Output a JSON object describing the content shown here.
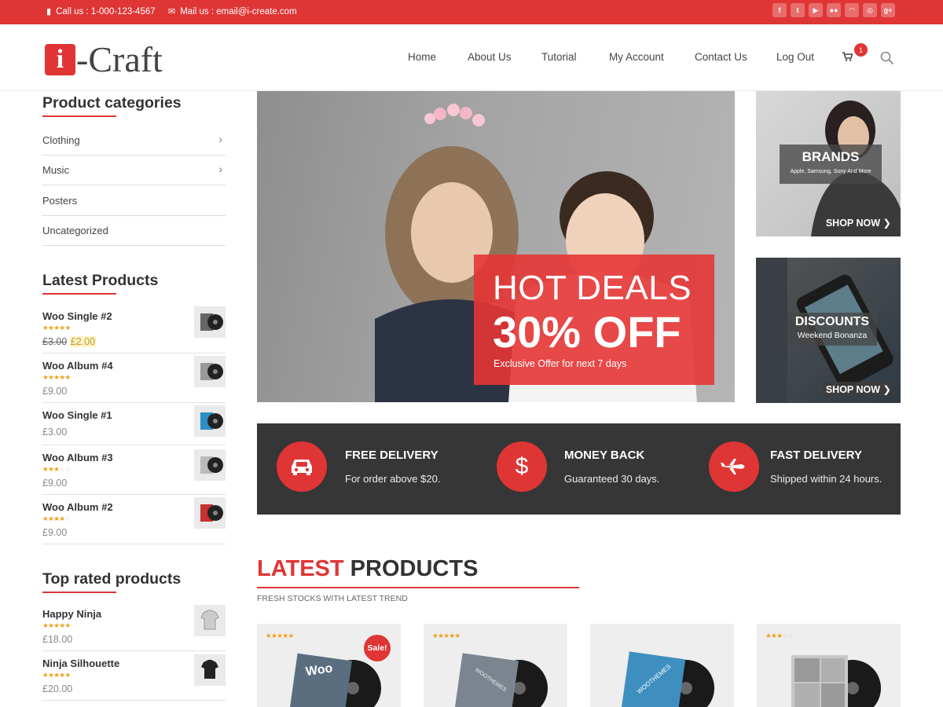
{
  "topbar": {
    "call": "Call us : 1-000-123-4567",
    "mail": "Mail us : email@i-create.com",
    "social_icons": [
      "facebook-icon",
      "twitter-icon",
      "youtube-icon",
      "flickr-icon",
      "rss-icon",
      "instagram-icon",
      "google-plus-icon"
    ],
    "color": "#e03535"
  },
  "brand": {
    "mark": "i",
    "word": "-Craft"
  },
  "nav": {
    "items": [
      "Home",
      "About Us",
      "Tutorial",
      "My Account",
      "Contact Us",
      "Log Out"
    ],
    "cart_count": "1"
  },
  "sidebar": {
    "categories_title": "Product categories",
    "categories": [
      {
        "label": "Clothing",
        "has_children": true
      },
      {
        "label": "Music",
        "has_children": true
      },
      {
        "label": "Posters",
        "has_children": false
      },
      {
        "label": "Uncategorized",
        "has_children": false
      }
    ],
    "latest_title": "Latest Products",
    "latest": [
      {
        "name": "Woo Single #2",
        "rating": 4.5,
        "old_price": "£3.00",
        "price": "£2.00"
      },
      {
        "name": "Woo Album #4",
        "rating": 5,
        "price": "£9.00"
      },
      {
        "name": "Woo Single #1",
        "rating": 0,
        "price": "£3.00"
      },
      {
        "name": "Woo Album #3",
        "rating": 3,
        "price": "£9.00"
      },
      {
        "name": "Woo Album #2",
        "rating": 4,
        "price": "£9.00"
      }
    ],
    "top_rated_title": "Top rated products",
    "top_rated": [
      {
        "name": "Happy Ninja",
        "rating": 5,
        "price": "£18.00"
      },
      {
        "name": "Ninja Silhouette",
        "rating": 5,
        "price": "£20.00"
      }
    ]
  },
  "hero": {
    "line1": "HOT DEALS",
    "line2": "30% OFF",
    "line3": "Exclusive Offer for next 7 days"
  },
  "promos": [
    {
      "title": "BRANDS",
      "subtitle": "Apple, Samsung, Sony And More",
      "cta": "SHOP NOW ❯"
    },
    {
      "title": "DISCOUNTS",
      "subtitle": "Weekend Bonanza",
      "cta": "SHOP NOW ❯"
    }
  ],
  "features": [
    {
      "icon": "car-icon",
      "title": "FREE DELIVERY",
      "sub": "For order above $20."
    },
    {
      "icon": "dollar-icon",
      "title": "MONEY BACK",
      "sub": "Guaranteed 30 days."
    },
    {
      "icon": "plane-icon",
      "title": "FAST DELIVERY",
      "sub": "Shipped within 24 hours."
    }
  ],
  "latest_section": {
    "title_red": "LATEST",
    "title_dark": " PRODUCTS",
    "subtitle": "FRESH STOCKS WITH LATEST TREND",
    "cards": [
      {
        "rating": 4.5,
        "sale": "Sale!",
        "art": "Woo"
      },
      {
        "rating": 5,
        "sale": "",
        "art": "WOOTHEMES"
      },
      {
        "rating": 0,
        "sale": "",
        "art": "WOOTHEMES"
      },
      {
        "rating": 3,
        "sale": "",
        "art": ""
      }
    ]
  }
}
